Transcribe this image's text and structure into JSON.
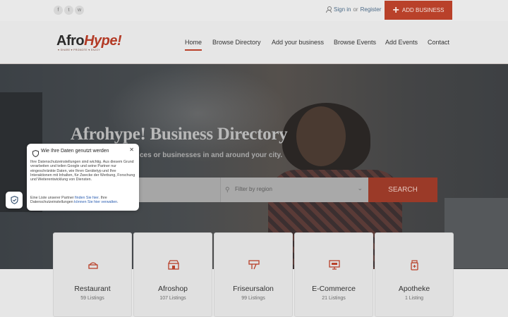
{
  "topbar": {
    "social_icons": [
      "facebook-icon",
      "twitter-icon",
      "whatsapp-icon"
    ],
    "sign_in": "Sign in",
    "or": "or",
    "register": "Register",
    "add_business": "ADD BUSINESS"
  },
  "brand": {
    "logo_main": "Afro",
    "logo_accent": "Hype!",
    "tagline": "♥ SHARE ♥ PROMOTE ♥ ENJOY"
  },
  "nav": {
    "items": [
      "Home",
      "Browse Directory",
      "Add your business",
      "Browse Events",
      "Add Events",
      "Contact"
    ],
    "active": "Home"
  },
  "hero": {
    "title": "Afrohype! Business Directory",
    "subtitle": "ces or businesses in and around your city."
  },
  "search": {
    "region_placeholder": "Filter by region",
    "button": "SEARCH"
  },
  "categories": [
    {
      "name": "Restaurant",
      "count": "59 Listings",
      "icon": "restaurant-icon"
    },
    {
      "name": "Afroshop",
      "count": "107 Listings",
      "icon": "shop-icon"
    },
    {
      "name": "Friseursalon",
      "count": "99 Listings",
      "icon": "salon-icon"
    },
    {
      "name": "E-Commerce",
      "count": "21 Listings",
      "icon": "ecommerce-icon"
    },
    {
      "name": "Apotheke",
      "count": "1 Listing",
      "icon": "pharmacy-icon"
    }
  ],
  "privacy_popup": {
    "title": "Wie Ihre Daten genutzt werden",
    "body": "Ihre Datenschutzeinstellungen sind wichtig. Aus diesem Grund verarbeiten und teilen Google und seine Partner nur eingeschränkte Daten, wie Ihren Gerätetyp und Ihre Interaktionen mit Inhalten, für Zwecke der Werbung, Forschung und Weiterentwicklung von Diensten.",
    "body2_pre": "Eine Liste unserer Partner ",
    "body2_link1": "finden Sie hier",
    "body2_mid": ". Ihre Datenschutzeinstellungen ",
    "body2_link2": "können Sie hier verwalten",
    "body2_end": "."
  },
  "colors": {
    "accent": "#b9412a",
    "link": "#2a5db0"
  }
}
